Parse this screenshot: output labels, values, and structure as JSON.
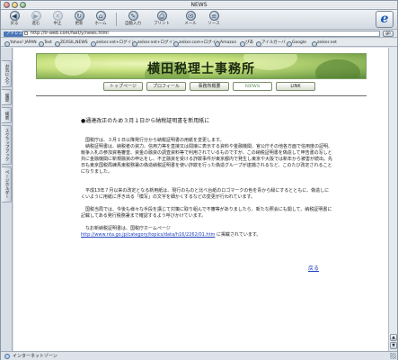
{
  "window": {
    "title": "NEWS"
  },
  "toolbar": {
    "buttons": [
      {
        "label": "戻る",
        "glyph": "◀"
      },
      {
        "label": "進む",
        "glyph": "▶"
      },
      {
        "label": "中止",
        "glyph": "✕"
      },
      {
        "label": "更新",
        "glyph": "↻"
      },
      {
        "label": "ホーム",
        "glyph": "⌂"
      },
      {
        "label": "自動入力",
        "glyph": "✎"
      },
      {
        "label": "プリント",
        "glyph": "⎙"
      },
      {
        "label": "メール",
        "glyph": "✉"
      },
      {
        "label": "ソース",
        "glyph": "≡"
      }
    ],
    "logo": "e"
  },
  "address": {
    "label": "アドレス",
    "value": "http://tr-web.com/fast/y/news.html",
    "go": "go"
  },
  "favorites": [
    "Yahoo! JAPAN",
    "Test",
    "ZEXSIL,NEWS",
    "zeiker.net+ログイン",
    "zeiker.net+ログイン",
    "zeiker.com+ログイン",
    "Amazon",
    "ぴあ",
    "アイルガーバ",
    "Google",
    "zeiker.net"
  ],
  "sidebar": {
    "tabs": [
      "お気に入り",
      "履歴",
      "検索",
      "スクラップブック",
      "ページホルダー"
    ]
  },
  "page": {
    "site_title": "横田税理士事務所",
    "nav": [
      "トップページ",
      "プロフィール",
      "事務所概要",
      "NEWS",
      "LINK"
    ],
    "heading": "●通達改正のため３月１日から納税証明書を新用紙に",
    "paragraphs": [
      "　国税庁は、３月１日以降発行分から納税証明書の用紙を変更します。",
      "　納税証明書は、納税者の資力、信用力等を直接又は間接に表示する資料や金融機関、官公庁その他各方面で信用度の証明、競争入札の参加資格審査、資金の融資の調査資料等で利用されているものですが、この納税証明書を偽造して申告書の写しと共に金融機関に新規融資の申込をし、不正融資を受ける詐欺事件が東京都内で発生し東京や大阪では新年から被害が続出。先日も東京国税局練馬東税務署の偽造納税証明書を使い詐欺を行った偽造グループが逮捕されるなど、このたび改定されることになりました。",
      "　平成13年７月以来の改定となる新用紙は、現行のものと比べ台紙のロゴマークの色を青から緑にするとともに、偽造しにくいように用紙に浮き出る「模写」の文字を細かくするなどの変更が行われています。",
      "　国税当局では、今後も様々な手段を講じて対策に取り組んで不審等がありましたら、新たな照会にも関して、納税証明書に記載してある発行税務署まで確認するよう呼びかけています。",
      "　なお新納税証明書は、国税庁ホームページ"
    ],
    "link": "http://www.nta.go.jp/category/topics/data/h16/2262/01.htm",
    "link_suffix": "に掲載されています。",
    "back": "戻る"
  },
  "status": {
    "text": "インターネットゾーン"
  }
}
